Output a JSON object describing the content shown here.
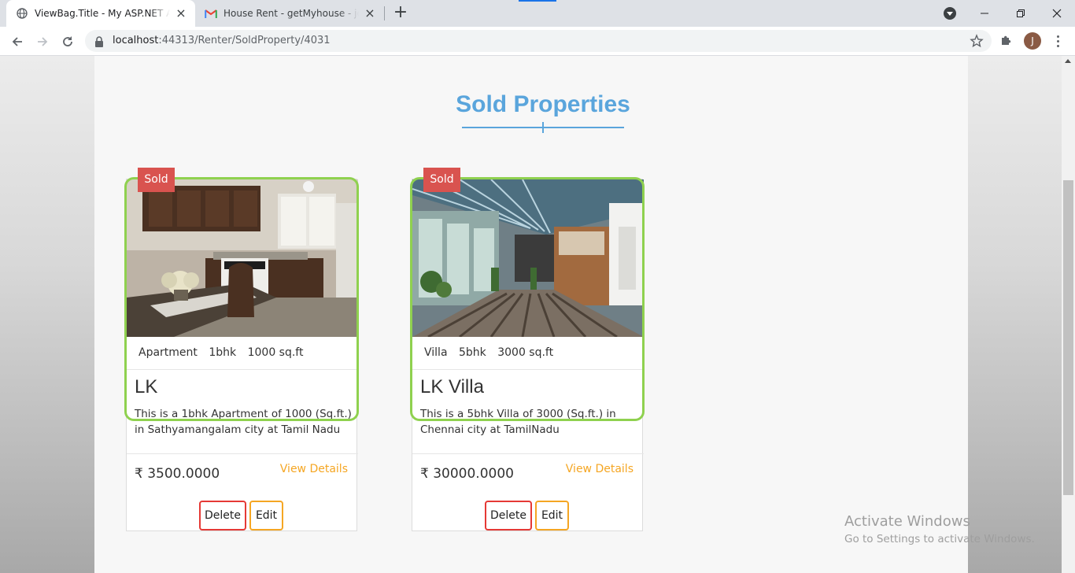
{
  "browser": {
    "tabs": [
      {
        "title": "ViewBag.Title - My ASP.NET Application",
        "active": true
      },
      {
        "title": "House Rent - getMyhouse - jothika",
        "active": false
      }
    ],
    "url_host": "localhost",
    "url_path": ":44313/Renter/SoldProperty/4031",
    "profile_initial": "J"
  },
  "page": {
    "title": "Sold Properties",
    "cards": [
      {
        "badge": "Sold",
        "type": "Apartment",
        "bhk": "1bhk",
        "area": "1000 sq.ft",
        "name": "LK",
        "description": "This is a 1bhk Apartment of 1000 (Sq.ft.) in Sathyamangalam city at Tamil Nadu",
        "price": "₹ 3500.0000",
        "view_label": "View Details",
        "delete_label": "Delete",
        "edit_label": "Edit"
      },
      {
        "badge": "Sold",
        "type": "Villa",
        "bhk": "5bhk",
        "area": "3000 sq.ft",
        "name": "LK Villa",
        "description": "This is a 5bhk Villa of 3000 (Sq.ft.) in Chennai city at TamilNadu",
        "price": "₹ 30000.0000",
        "view_label": "View Details",
        "delete_label": "Delete",
        "edit_label": "Edit"
      }
    ]
  },
  "watermark": {
    "line1": "Activate Windows",
    "line2": "Go to Settings to activate Windows."
  },
  "colors": {
    "accent_title": "#5aa5dc",
    "sold_badge": "#d9534f",
    "card_border": "#8fd14f",
    "link": "#f5a623",
    "delete_border": "#e53935",
    "edit_border": "#f5a623"
  }
}
